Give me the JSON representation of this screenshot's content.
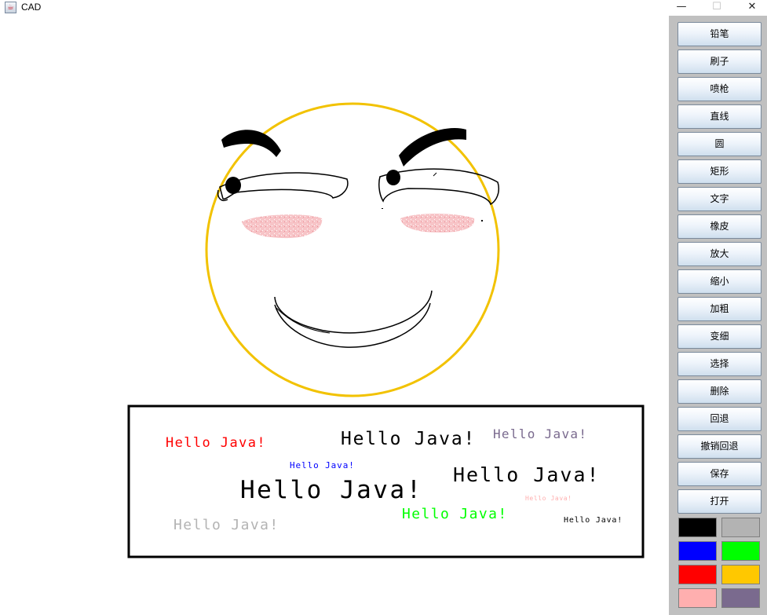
{
  "window": {
    "title": "CAD",
    "minimize_glyph": "—",
    "maximize_glyph": "☐",
    "close_glyph": "✕"
  },
  "tools": [
    {
      "id": "pencil",
      "label": "铅笔"
    },
    {
      "id": "brush",
      "label": "刷子"
    },
    {
      "id": "spray",
      "label": "喷枪"
    },
    {
      "id": "line",
      "label": "直线"
    },
    {
      "id": "circle",
      "label": "圆"
    },
    {
      "id": "rect",
      "label": "矩形"
    },
    {
      "id": "text",
      "label": "文字"
    },
    {
      "id": "eraser",
      "label": "橡皮"
    },
    {
      "id": "zoom-in",
      "label": "放大"
    },
    {
      "id": "zoom-out",
      "label": "缩小"
    },
    {
      "id": "thicken",
      "label": "加粗"
    },
    {
      "id": "thin",
      "label": "变细"
    },
    {
      "id": "select",
      "label": "选择"
    },
    {
      "id": "delete",
      "label": "删除"
    },
    {
      "id": "undo",
      "label": "回退"
    },
    {
      "id": "redo",
      "label": "撤销回退"
    },
    {
      "id": "save",
      "label": "保存"
    },
    {
      "id": "open",
      "label": "打开"
    }
  ],
  "palette": [
    {
      "name": "black",
      "color": "#000000"
    },
    {
      "name": "gray",
      "color": "#b3b3b3"
    },
    {
      "name": "blue",
      "color": "#0000ff"
    },
    {
      "name": "green",
      "color": "#00ff00"
    },
    {
      "name": "red",
      "color": "#ff0000"
    },
    {
      "name": "yellow",
      "color": "#ffc800"
    },
    {
      "name": "pink",
      "color": "#ffafaf"
    },
    {
      "name": "purple",
      "color": "#7a6a8e"
    }
  ],
  "drawing": {
    "face_color": "#f2c200",
    "blush_color": "#f4a5aa",
    "stroke_color": "#000000",
    "texts": [
      {
        "text": "Hello Java!",
        "color": "#ff0000",
        "size": "medium"
      },
      {
        "text": "Hello Java!",
        "color": "#000000",
        "size": "large"
      },
      {
        "text": "Hello Java!",
        "color": "#7a6a8e",
        "size": "medium"
      },
      {
        "text": "Hello Java!",
        "color": "#0000ff",
        "size": "small"
      },
      {
        "text": "Hello Java!",
        "color": "#000000",
        "size": "x-large"
      },
      {
        "text": "Hello Java!",
        "color": "#000000",
        "size": "large"
      },
      {
        "text": "Hello Java!",
        "color": "#ffafaf",
        "size": "tiny"
      },
      {
        "text": "Hello Java!",
        "color": "#00ff00",
        "size": "medium"
      },
      {
        "text": "Hello Java!",
        "color": "#b3b3b3",
        "size": "medium"
      },
      {
        "text": "Hello Java!",
        "color": "#000000",
        "size": "small"
      }
    ]
  }
}
